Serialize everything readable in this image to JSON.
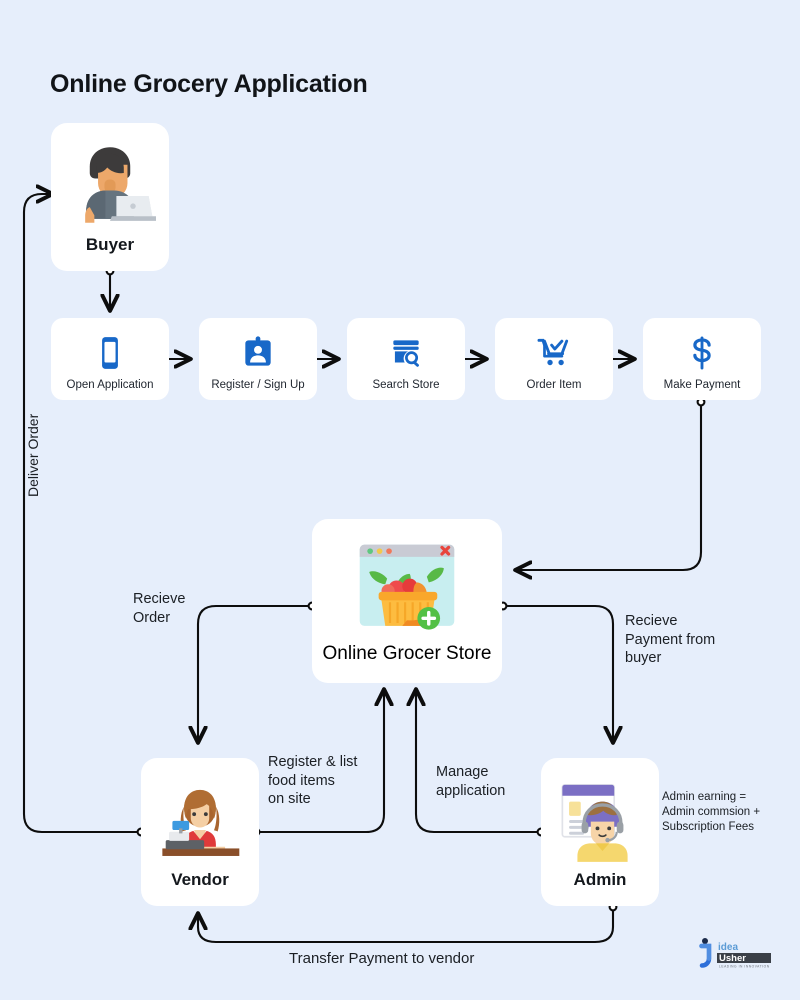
{
  "diagram": {
    "title": "Online Grocery Application",
    "background_color": "#e6eefb",
    "card_color": "#ffffff",
    "accent_color": "#1868c8",
    "line_color": "#0d0d0d"
  },
  "actors": {
    "buyer": {
      "label": "Buyer",
      "icon": "buyer-person-laptop-icon"
    },
    "store": {
      "label": "Online Grocer Store",
      "icon": "browser-grocery-basket-icon"
    },
    "vendor": {
      "label": "Vendor",
      "icon": "vendor-cashier-icon"
    },
    "admin": {
      "label": "Admin",
      "icon": "admin-support-agent-icon"
    }
  },
  "steps": [
    {
      "label": "Open Application",
      "icon": "mobile-phone-icon"
    },
    {
      "label": "Register / Sign Up",
      "icon": "id-card-person-icon"
    },
    {
      "label": "Search Store",
      "icon": "store-search-icon"
    },
    {
      "label": "Order Item",
      "icon": "shopping-cart-check-icon"
    },
    {
      "label": "Make Payment",
      "icon": "dollar-sign-icon"
    }
  ],
  "edge_labels": {
    "deliver_order": "Deliver Order",
    "recieve_order": "Recieve\nOrder",
    "recieve_payment": "Recieve\nPayment from\nbuyer",
    "register_list": "Register & list\nfood items\non site",
    "manage_application": "Manage\napplication",
    "admin_earning": "Admin earning =\nAdmin commsion +\nSubscription Fees",
    "transfer_payment": "Transfer Payment to vendor"
  },
  "brand": {
    "name": "Idea Usher",
    "word_one": "idea",
    "word_two": "Usher",
    "tagline": "LEADING IN INNOVATION"
  }
}
